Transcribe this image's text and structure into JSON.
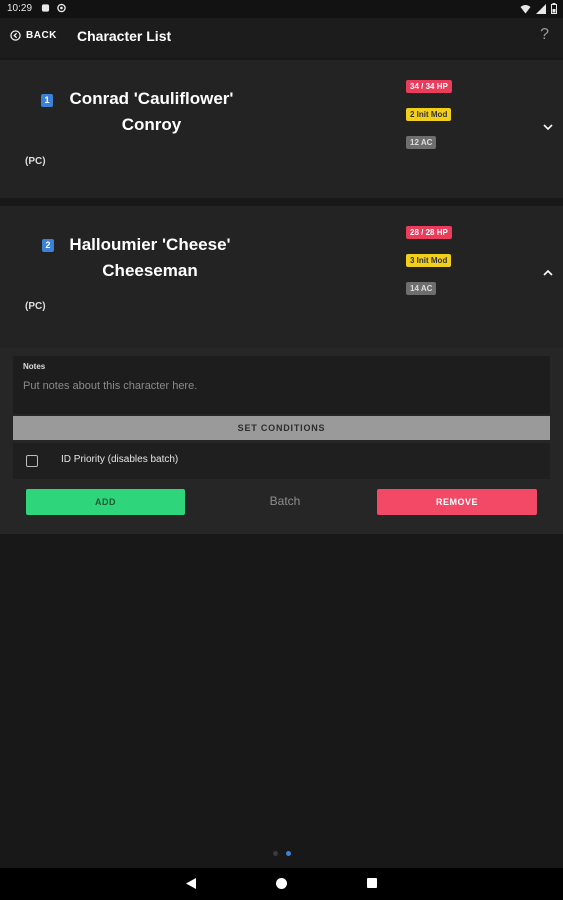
{
  "status_bar": {
    "time": "10:29"
  },
  "app_bar": {
    "back_label": "BACK",
    "title": "Character List",
    "help_label": "?"
  },
  "characters": [
    {
      "index": "1",
      "name_line1": "Conrad 'Cauliflower'",
      "name_line2": "Conroy",
      "type": "(PC)",
      "hp": "34 / 34 HP",
      "init": "2 Init Mod",
      "ac": "12 AC",
      "expanded": false
    },
    {
      "index": "2",
      "name_line1": "Halloumier 'Cheese'",
      "name_line2": "Cheeseman",
      "type": "(PC)",
      "hp": "28 / 28 HP",
      "init": "3 Init Mod",
      "ac": "14 AC",
      "expanded": true
    }
  ],
  "detail": {
    "notes_label": "Notes",
    "notes_placeholder": "Put notes about this character here.",
    "set_conditions_label": "SET CONDITIONS",
    "priority_label": "ID Priority (disables batch)",
    "priority_checked": false,
    "add_label": "ADD",
    "batch_label": "Batch",
    "remove_label": "REMOVE"
  },
  "pager": {
    "pages": 2,
    "active": 1
  },
  "colors": {
    "hp": "#ea3d5c",
    "init": "#f2cf1b",
    "ac": "#6e6e6e",
    "add": "#2ed57a",
    "remove": "#f24967",
    "index": "#3b82d6"
  }
}
